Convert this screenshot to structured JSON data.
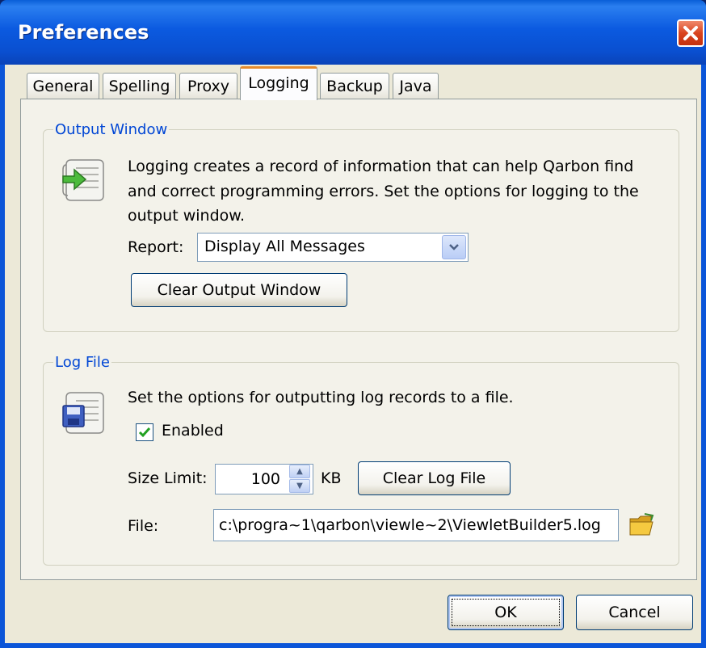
{
  "window": {
    "title": "Preferences",
    "close_symbol": "✕"
  },
  "tabs": [
    {
      "label": "General",
      "active": false
    },
    {
      "label": "Spelling",
      "active": false
    },
    {
      "label": "Proxy",
      "active": false
    },
    {
      "label": "Logging",
      "active": true
    },
    {
      "label": "Backup",
      "active": false
    },
    {
      "label": "Java",
      "active": false
    }
  ],
  "output_window": {
    "group_title": "Output Window",
    "description_line1": "Logging creates a record of information that can help Qarbon find",
    "description_line2": "and correct programming errors. Set the options for logging to the",
    "description_line3": "output window.",
    "report_label": "Report:",
    "report_value": "Display All Messages",
    "clear_button": "Clear Output Window"
  },
  "log_file": {
    "group_title": "Log File",
    "description": "Set the options for outputting log records to a file.",
    "enabled_label": "Enabled",
    "enabled_checked": true,
    "size_limit_label": "Size Limit:",
    "size_limit_value": "100",
    "size_unit": "KB",
    "clear_button": "Clear Log File",
    "file_label": "File:",
    "file_value": "c:\\progra~1\\qarbon\\viewle~2\\ViewletBuilder5.log"
  },
  "footer": {
    "ok_label": "OK",
    "cancel_label": "Cancel"
  },
  "icons": [
    "output-scroll-icon",
    "log-file-scroll-icon",
    "folder-open-icon",
    "dropdown-arrow-icon",
    "spin-up-icon",
    "spin-down-icon",
    "check-icon",
    "close-icon"
  ]
}
